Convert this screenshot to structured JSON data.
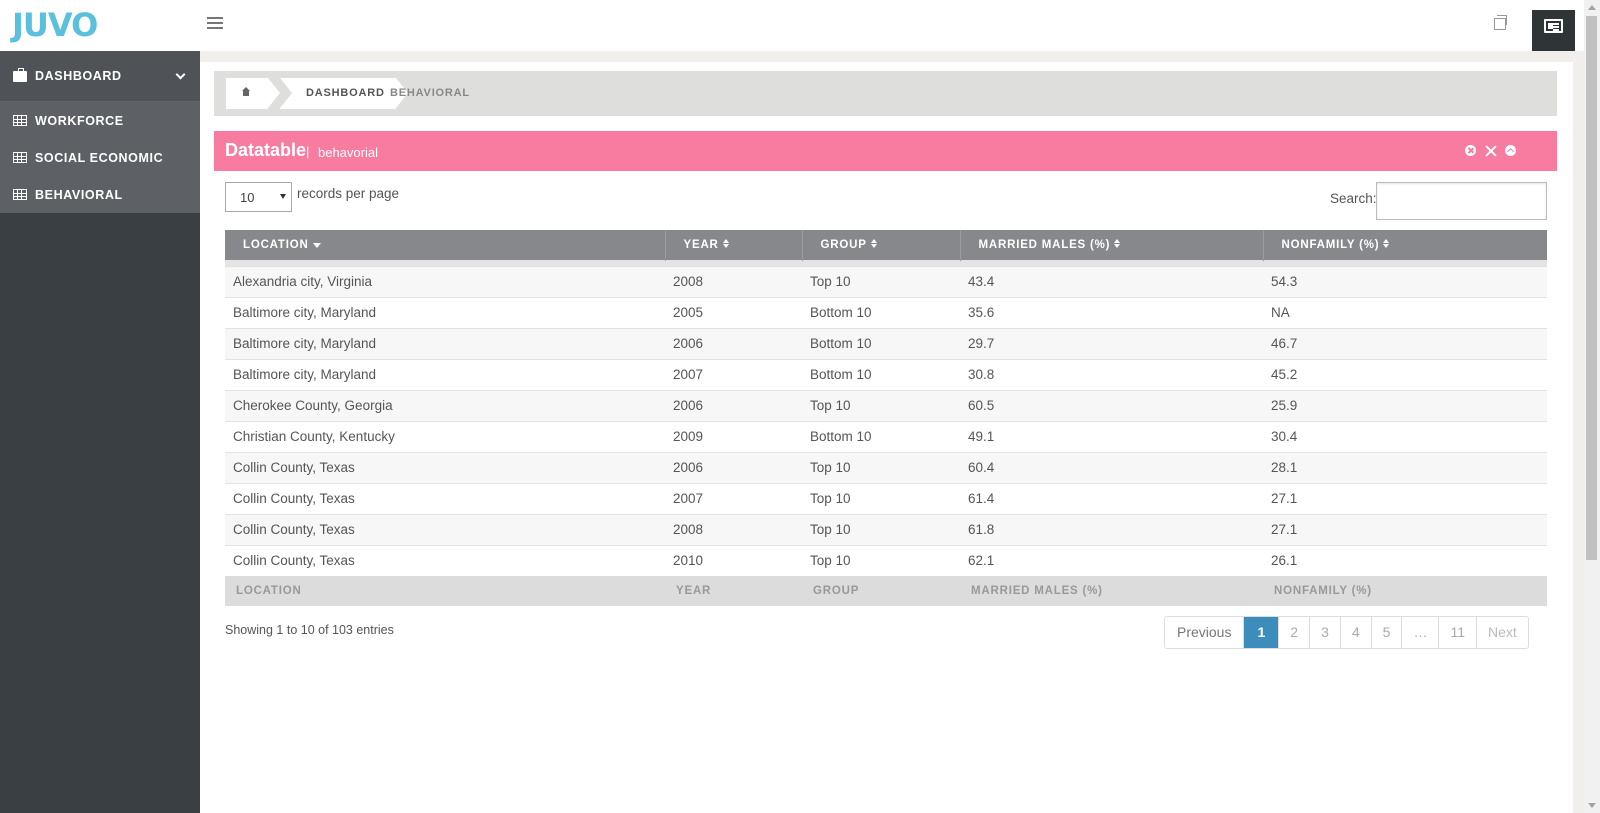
{
  "app": {
    "logo": "JUVO"
  },
  "sidebar": {
    "items": [
      {
        "label": "DASHBOARD",
        "icon": "briefcase-icon"
      },
      {
        "label": "WORKFORCE",
        "icon": "table-icon"
      },
      {
        "label": "SOCIAL ECONOMIC",
        "icon": "table-icon"
      },
      {
        "label": "BEHAVIORAL",
        "icon": "table-icon"
      }
    ]
  },
  "breadcrumb": {
    "home_icon": "home-icon",
    "items": [
      "DASHBOARD",
      "BEHAVIORAL"
    ]
  },
  "widget": {
    "title": "Datatable",
    "separator": "|",
    "subtitle": "behavorial",
    "header_color": "#f77ca0"
  },
  "controls": {
    "page_length": "10",
    "page_length_label": "records per page",
    "search_label": "Search:",
    "search_value": ""
  },
  "table": {
    "columns": [
      "LOCATION",
      "YEAR",
      "GROUP",
      "MARRIED MALES (%)",
      "NONFAMILY (%)"
    ],
    "rows": [
      [
        "Alexandria city, Virginia",
        "2008",
        "Top 10",
        "43.4",
        "54.3"
      ],
      [
        "Baltimore city, Maryland",
        "2005",
        "Bottom 10",
        "35.6",
        "NA"
      ],
      [
        "Baltimore city, Maryland",
        "2006",
        "Bottom 10",
        "29.7",
        "46.7"
      ],
      [
        "Baltimore city, Maryland",
        "2007",
        "Bottom 10",
        "30.8",
        "45.2"
      ],
      [
        "Cherokee County, Georgia",
        "2006",
        "Top 10",
        "60.5",
        "25.9"
      ],
      [
        "Christian County, Kentucky",
        "2009",
        "Bottom 10",
        "49.1",
        "30.4"
      ],
      [
        "Collin County, Texas",
        "2006",
        "Top 10",
        "60.4",
        "28.1"
      ],
      [
        "Collin County, Texas",
        "2007",
        "Top 10",
        "61.4",
        "27.1"
      ],
      [
        "Collin County, Texas",
        "2008",
        "Top 10",
        "61.8",
        "27.1"
      ],
      [
        "Collin County, Texas",
        "2010",
        "Top 10",
        "62.1",
        "26.1"
      ]
    ]
  },
  "pagination": {
    "info": "Showing 1 to 10 of 103 entries",
    "previous": "Previous",
    "pages": [
      "1",
      "2",
      "3",
      "4",
      "5",
      "…",
      "11"
    ],
    "next": "Next",
    "active_color": "#3c8dbc"
  }
}
